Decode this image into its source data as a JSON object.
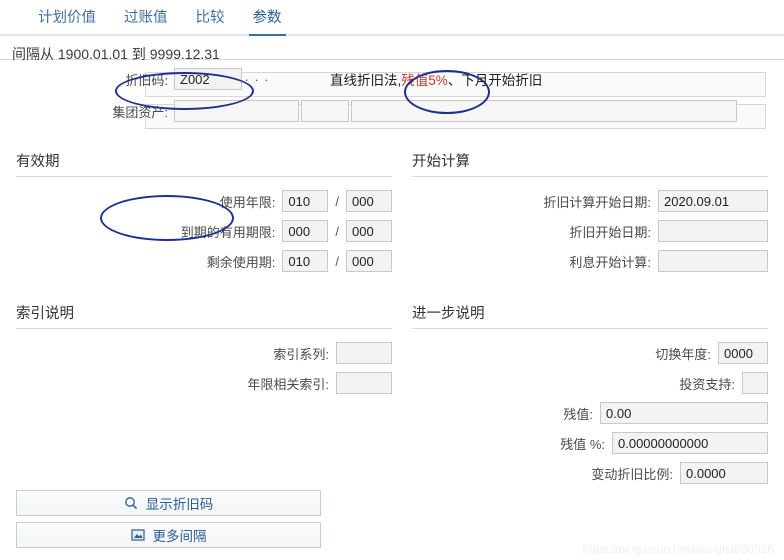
{
  "tabs": [
    {
      "label": "计划价值",
      "active": false
    },
    {
      "label": "过账值",
      "active": false
    },
    {
      "label": "比较",
      "active": false
    },
    {
      "label": "参数",
      "active": true
    }
  ],
  "interval": {
    "prefix": "间隔从",
    "from": "1900.01.01",
    "middle": "到",
    "to": "9999.12.31"
  },
  "top_form": {
    "dep_code_label": "折旧码:",
    "dep_code_value": "Z002",
    "ellipsis_button": "· · ·",
    "description_prefix": "直线折旧法,",
    "description_highlight": "残值5%",
    "description_suffix": "、下月开始折旧",
    "group_asset_label": "集团资产:",
    "group_asset_value_1": "",
    "group_asset_value_2": "",
    "group_asset_value_3": ""
  },
  "sections": {
    "useful_life": {
      "title": "有效期",
      "rows": [
        {
          "label": "使用年限:",
          "years": "010",
          "sep": "/",
          "periods": "000"
        },
        {
          "label": "到期的有用期限:",
          "years": "000",
          "sep": "/",
          "periods": "000"
        },
        {
          "label": "剩余使用期:",
          "years": "010",
          "sep": "/",
          "periods": "000"
        }
      ]
    },
    "start_calc": {
      "title": "开始计算",
      "rows": [
        {
          "label": "折旧计算开始日期:",
          "value": "2020.09.01"
        },
        {
          "label": "折旧开始日期:",
          "value": ""
        },
        {
          "label": "利息开始计算:",
          "value": ""
        }
      ]
    },
    "index_desc": {
      "title": "索引说明",
      "rows": [
        {
          "label": "索引系列:",
          "value": ""
        },
        {
          "label": "年限相关索引:",
          "value": ""
        }
      ]
    },
    "further_desc": {
      "title": "进一步说明",
      "rows": [
        {
          "label": "切换年度:",
          "value": "0000"
        },
        {
          "label": "投资支持:",
          "value": ""
        },
        {
          "label": "残值:",
          "value": "0.00"
        },
        {
          "label": "残值 %:",
          "value": "0.00000000000"
        },
        {
          "label": "变动折旧比例:",
          "value": "0.0000"
        }
      ]
    }
  },
  "buttons": [
    {
      "label": "显示折旧码",
      "icon": "magnifier-icon"
    },
    {
      "label": "更多间隔",
      "icon": "image-icon"
    }
  ],
  "watermark": "https://blog.csdn.net/wanglei880526",
  "colors": {
    "accent": "#3a6ea5",
    "annotation": "#1f2f8f",
    "highlight": "#c0392b",
    "field_bg": "#f3f3f3"
  }
}
